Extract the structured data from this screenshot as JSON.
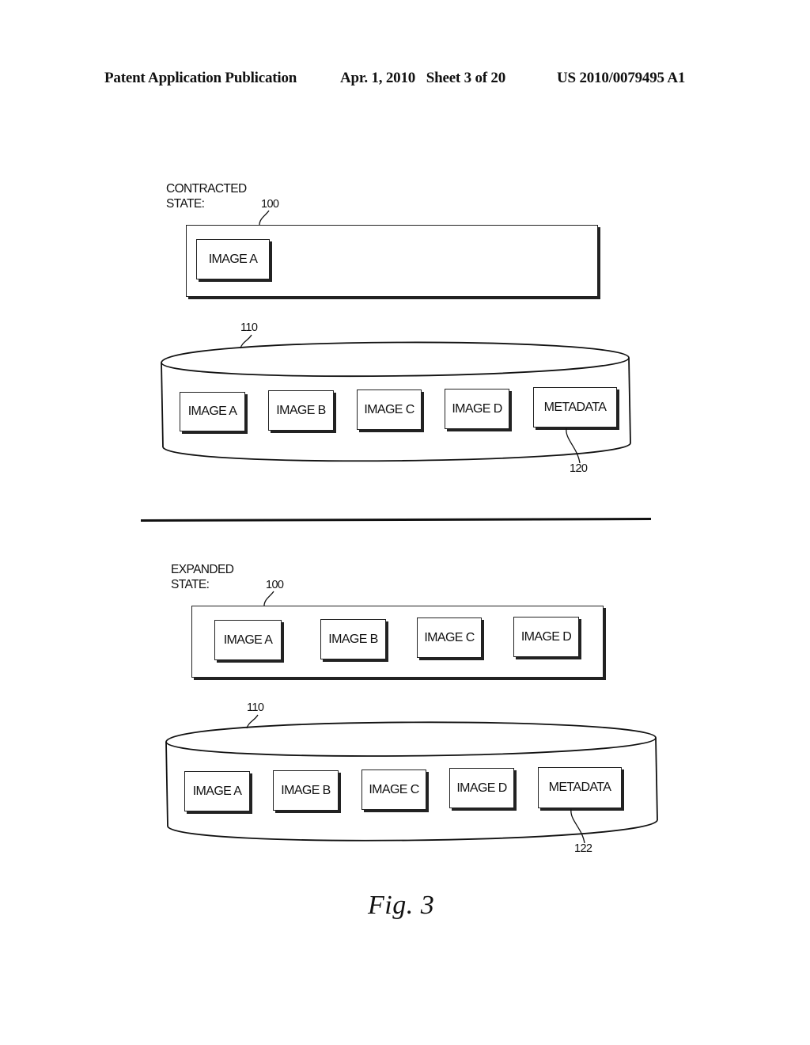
{
  "header": {
    "publication_type": "Patent Application Publication",
    "date_sheet": "Apr. 1, 2010   Sheet 3 of 20",
    "patent_number": "US 2010/0079495 A1"
  },
  "contracted": {
    "state_label_line1": "CONTRACTED",
    "state_label_line2": "STATE:",
    "display_ref": "100",
    "display_items": [
      "IMAGE A"
    ],
    "storage_ref": "110",
    "storage_items": [
      "IMAGE A",
      "IMAGE B",
      "IMAGE C",
      "IMAGE D",
      "METADATA"
    ],
    "metadata_ref": "120"
  },
  "expanded": {
    "state_label_line1": "EXPANDED",
    "state_label_line2": "STATE:",
    "display_ref": "100",
    "display_items": [
      "IMAGE A",
      "IMAGE B",
      "IMAGE C",
      "IMAGE D"
    ],
    "storage_ref": "110",
    "storage_items": [
      "IMAGE A",
      "IMAGE B",
      "IMAGE C",
      "IMAGE D",
      "METADATA"
    ],
    "metadata_ref": "122"
  },
  "figure_caption": "Fig. 3"
}
